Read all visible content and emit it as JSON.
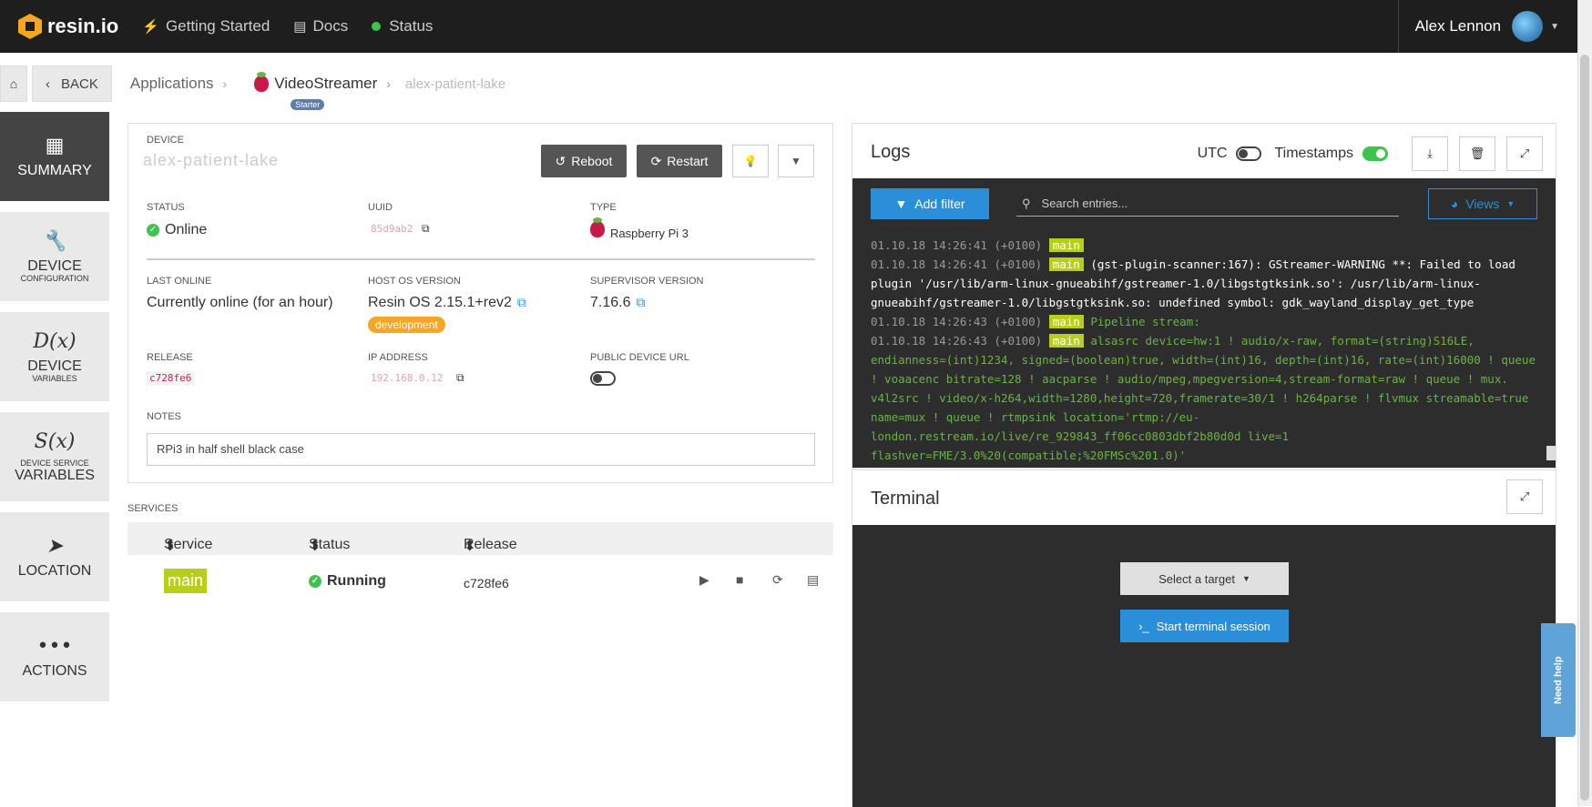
{
  "topnav": {
    "logo_text": "resin.io",
    "links": [
      {
        "label": "Getting Started",
        "icon": "bolt-icon"
      },
      {
        "label": "Docs",
        "icon": "doc-icon"
      },
      {
        "label": "Status",
        "icon": "status-dot-icon"
      }
    ],
    "user_name": "Alex Lennon"
  },
  "breadcrumb": {
    "back_label": "BACK",
    "applications": "Applications",
    "app_name": "VideoStreamer",
    "app_badge": "Starter",
    "device_name": "alex-patient-lake"
  },
  "sidebar": {
    "items": [
      {
        "icon": "▦",
        "label": "SUMMARY",
        "sub": ""
      },
      {
        "icon": "🔧",
        "label": "DEVICE",
        "sub": "CONFIGURATION"
      },
      {
        "icon": "D(x)",
        "label": "DEVICE",
        "sub": "VARIABLES"
      },
      {
        "icon": "S(x)",
        "label": "VARIABLES",
        "sub": "DEVICE SERVICE"
      },
      {
        "icon": "➤",
        "label": "LOCATION",
        "sub": ""
      },
      {
        "icon": "•••",
        "label": "ACTIONS",
        "sub": ""
      }
    ]
  },
  "device": {
    "section_label": "DEVICE",
    "name": "alex-patient-lake",
    "reboot_label": "Reboot",
    "restart_label": "Restart",
    "status_label": "STATUS",
    "status_value": "Online",
    "uuid_label": "UUID",
    "uuid_value": "85d9ab2",
    "type_label": "TYPE",
    "type_value": "Raspberry Pi 3",
    "last_online_label": "LAST ONLINE",
    "last_online_value": "Currently online (for an hour)",
    "host_os_label": "HOST OS VERSION",
    "host_os_value": "Resin OS 2.15.1+rev2",
    "host_os_badge": "development",
    "supervisor_label": "SUPERVISOR VERSION",
    "supervisor_value": "7.16.6",
    "release_label": "RELEASE",
    "release_value": "c728fe6",
    "ip_label": "IP ADDRESS",
    "ip_value": "192.168.0.12",
    "public_url_label": "PUBLIC DEVICE URL",
    "notes_label": "NOTES",
    "notes_value": "RPi3 in half shell black case"
  },
  "services": {
    "label": "SERVICES",
    "headers": [
      "Service",
      "Status",
      "Release"
    ],
    "rows": [
      {
        "service": "main",
        "status": "Running",
        "release": "c728fe6"
      }
    ]
  },
  "logs": {
    "title": "Logs",
    "utc_label": "UTC",
    "timestamps_label": "Timestamps",
    "add_filter_label": "Add filter",
    "search_placeholder": "Search entries...",
    "views_label": "Views",
    "lines": [
      {
        "ts": "01.10.18 14:26:41 (+0100)",
        "svc": "main",
        "msg": ""
      },
      {
        "ts": "01.10.18 14:26:41 (+0100)",
        "svc": "main",
        "msg": "(gst-plugin-scanner:167): GStreamer-WARNING **: Failed to load plugin '/usr/lib/arm-linux-gnueabihf/gstreamer-1.0/libgstgtksink.so': /usr/lib/arm-linux-gnueabihf/gstreamer-1.0/libgstgtksink.so: undefined symbol: gdk_wayland_display_get_type"
      },
      {
        "ts": "01.10.18 14:26:43 (+0100)",
        "svc": "main",
        "msg": "Pipeline stream:"
      },
      {
        "ts": "01.10.18 14:26:43 (+0100)",
        "svc": "main",
        "msg": "alsasrc device=hw:1 ! audio/x-raw, format=(string)S16LE, endianness=(int)1234, signed=(boolean)true, width=(int)16, depth=(int)16, rate=(int)16000 ! queue ! voaacenc bitrate=128 ! aacparse ! audio/mpeg,mpegversion=4,stream-format=raw ! queue ! mux. v4l2src !  video/x-h264,width=1280,height=720,framerate=30/1 ! h264parse ! flvmux streamable=true name=mux ! queue ! rtmpsink location='rtmp://eu-london.restream.io/live/re_929843_ff06cc0803dbf2b80d0d live=1 flashver=FME/3.0%20(compatible;%20FMSc%201.0)'"
      }
    ]
  },
  "terminal": {
    "title": "Terminal",
    "select_target_label": "Select a target",
    "start_label": "Start terminal session"
  },
  "help_label": "Need help",
  "colors": {
    "accent": "#2a8fd8",
    "success": "#3ec44d",
    "service_tag": "#b8cf1a",
    "warning_badge": "#f6a623"
  }
}
